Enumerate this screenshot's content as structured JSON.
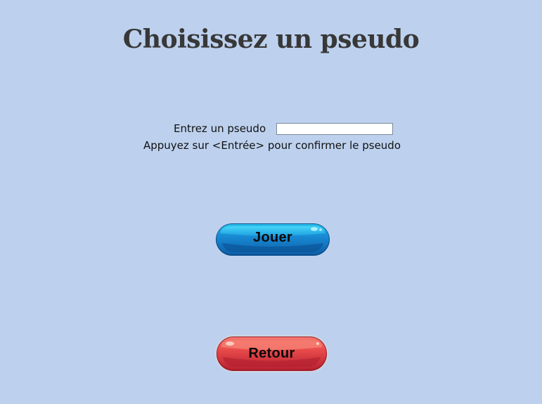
{
  "page": {
    "title": "Choisissez un pseudo"
  },
  "form": {
    "pseudo_label": "Entrez un pseudo",
    "pseudo_value": "",
    "hint": "Appuyez sur <Entrée> pour confirmer le pseudo"
  },
  "buttons": {
    "play_label": "Jouer",
    "play_color": "#1a8ed8",
    "back_label": "Retour",
    "back_color": "#e84a4a"
  },
  "colors": {
    "background": "#bdd1ee",
    "title": "#383838"
  }
}
